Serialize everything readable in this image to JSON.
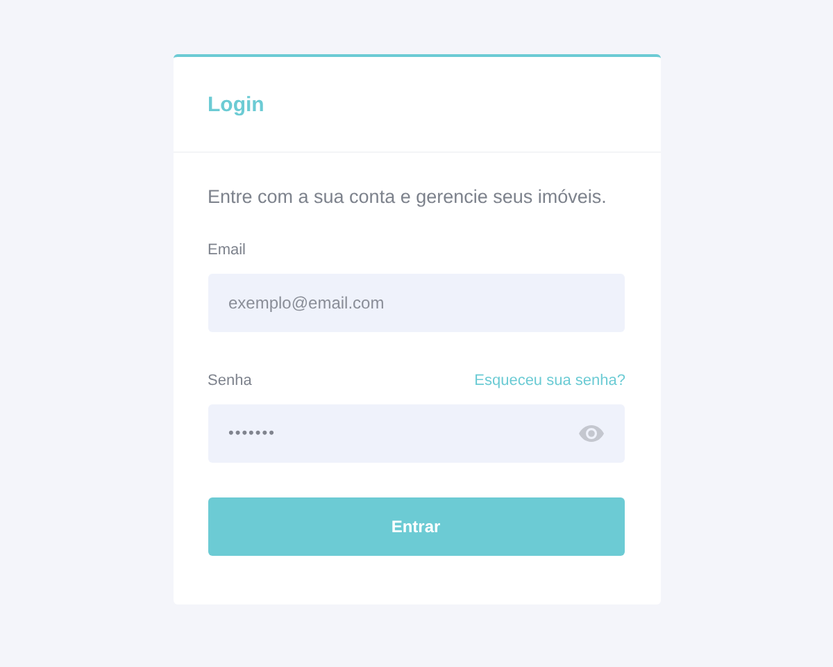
{
  "card": {
    "title": "Login",
    "intro": "Entre com a sua conta e gerencie seus imóveis."
  },
  "email": {
    "label": "Email",
    "placeholder": "exemplo@email.com"
  },
  "password": {
    "label": "Senha",
    "forgot_link": "Esqueceu sua senha?",
    "value": "•••••••"
  },
  "submit": "Entrar"
}
